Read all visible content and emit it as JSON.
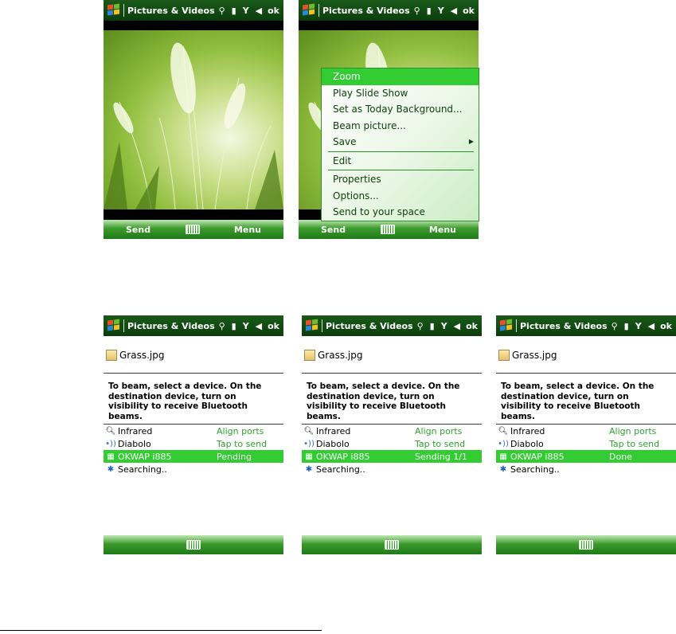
{
  "titlebar": {
    "title": "Pictures & Videos",
    "ok": "ok",
    "icons": [
      "start-icon",
      "network-icon",
      "battery-icon",
      "signal-icon",
      "volume-mute-icon"
    ]
  },
  "screen1": {
    "softkey_left": "Send",
    "softkey_right": "Menu"
  },
  "screen2": {
    "softkey_left": "Send",
    "softkey_right": "Menu",
    "menu": [
      {
        "label": "Zoom",
        "selected": true
      },
      {
        "label": "Play Slide Show"
      },
      {
        "label": "Set as Today Background..."
      },
      {
        "label": "Beam picture..."
      },
      {
        "label": "Save",
        "submenu": true
      },
      {
        "label": "Edit"
      },
      {
        "label": "Properties"
      },
      {
        "label": "Options..."
      },
      {
        "label": "Send to your space"
      }
    ]
  },
  "beam": {
    "file_name": "Grass.jpg",
    "instructions": "To beam, select a device. On the destination device, turn on visibility to receive Bluetooth beams.",
    "devices": [
      {
        "name": "Infrared",
        "status": "Align ports",
        "icon": "magnifier-icon"
      },
      {
        "name": "Diabolo",
        "status": "Tap to send",
        "icon": "wireless-icon"
      },
      {
        "name": "OKWAP i885",
        "status": "",
        "icon": "device-icon",
        "selected": true
      },
      {
        "name": "Searching..",
        "status": "",
        "icon": "bluetooth-icon"
      }
    ],
    "statuses": [
      "Pending",
      "Sending 1/1",
      "Done"
    ]
  },
  "colors": {
    "titlebar": "#0c3d0c",
    "accent": "#33cc33",
    "status_text": "#2fa32f"
  }
}
